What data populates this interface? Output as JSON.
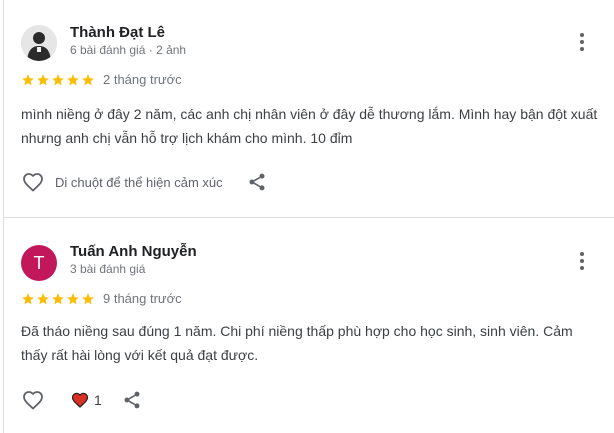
{
  "reviews": [
    {
      "reviewer_name": "Thành Đạt Lê",
      "meta": "6 bài đánh giá · 2 ảnh",
      "rating": 5,
      "time": "2 tháng trước",
      "text": "mình niềng ở đây 2 năm, các anh chị nhân viên ở đây dễ thương lắm. Mình hay bận đột xuất nhưng anh chị vẫn hỗ trợ lịch khám cho mình. 10 đỉm",
      "reaction_prompt": "Di chuột để thể hiện cảm xúc"
    },
    {
      "reviewer_name": "Tuấn Anh Nguyễn",
      "avatar_letter": "T",
      "meta": "3 bài đánh giá",
      "rating": 5,
      "time": "9 tháng trước",
      "text": "Đã tháo niềng sau đúng 1 năm. Chi phí niềng thấp phù hợp cho học sinh, sinh viên. Cảm thấy rất hài lòng với kết quả đạt được.",
      "like_count": "1"
    }
  ],
  "icons": {
    "star": "star-icon",
    "more": "more-vert-icon",
    "like": "heart-outline-icon",
    "liked": "heart-filled-icon",
    "share": "share-icon"
  },
  "colors": {
    "star": "#fbbc04",
    "heart_filled": "#d93025",
    "avatar_t": "#c2185b"
  }
}
